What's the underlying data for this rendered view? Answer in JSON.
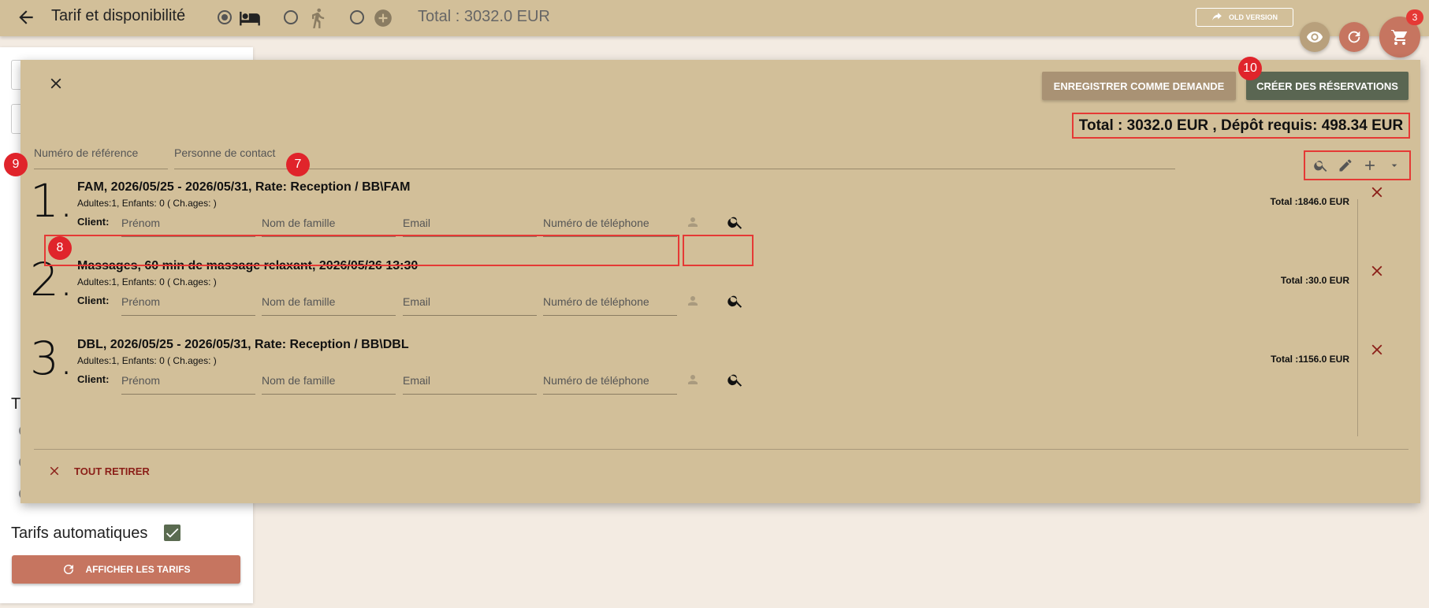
{
  "header": {
    "title": "Tarif et disponibilité",
    "total": "Total : 3032.0 EUR",
    "old_version": "OLD VERSION",
    "cart_count": "3"
  },
  "left": {
    "t_letter": "T",
    "auto_tarifs": "Tarifs automatiques",
    "afficher": "AFFICHER LES TARIFS"
  },
  "dialog": {
    "btn_enregistrer": "ENREGISTRER COMME DEMANDE",
    "btn_creer": "CRÉER DES RÉSERVATIONS",
    "total_line": "Total : 3032.0 EUR , Dépôt requis: 498.34 EUR",
    "ref_placeholder": "Numéro de référence",
    "contact_placeholder": "Personne de contact",
    "client_label": "Client:",
    "placeholders": {
      "first": "Prénom",
      "last": "Nom de famille",
      "email": "Email",
      "phone": "Numéro de téléphone"
    },
    "items": [
      {
        "num": "1.",
        "head": "FAM, 2026/05/25 - 2026/05/31, Rate: Reception / BB\\FAM",
        "sub": "Adultes:1, Enfants: 0 ( Ch.ages: )",
        "total": "Total :1846.0 EUR"
      },
      {
        "num": "2.",
        "head": "Massages, 60 min de massage relaxant, 2026/05/26 13:30",
        "sub": "Adultes:1, Enfants: 0 ( Ch.ages: )",
        "total": "Total :30.0 EUR"
      },
      {
        "num": "3.",
        "head": "DBL, 2026/05/25 - 2026/05/31, Rate: Reception / BB\\DBL",
        "sub": "Adultes:1, Enfants: 0 ( Ch.ages: )",
        "total": "Total :1156.0 EUR"
      }
    ],
    "remove_all": "TOUT RETIRER"
  },
  "markers": {
    "m7": "7",
    "m8": "8",
    "m9": "9",
    "m10": "10"
  },
  "colors": {
    "bar": "#d2bf99",
    "accent": "#c67560",
    "create": "#5a6652",
    "annotation": "#e53935"
  }
}
